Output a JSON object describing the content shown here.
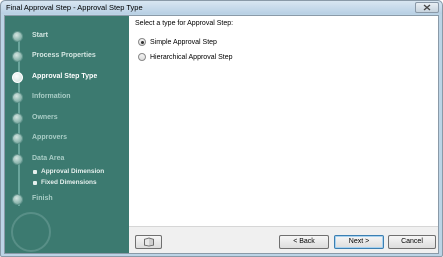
{
  "window": {
    "title": "Final Approval Step - Approval Step Type"
  },
  "sidebar": {
    "steps": [
      {
        "label": "Start",
        "state": "done"
      },
      {
        "label": "Process Properties",
        "state": "done"
      },
      {
        "label": "Approval Step Type",
        "state": "current"
      },
      {
        "label": "Information",
        "state": "pending"
      },
      {
        "label": "Owners",
        "state": "pending"
      },
      {
        "label": "Approvers",
        "state": "pending"
      },
      {
        "label": "Data Area",
        "state": "pending"
      },
      {
        "label": "Finish",
        "state": "pending"
      }
    ],
    "substeps": [
      {
        "label": "Approval Dimension"
      },
      {
        "label": "Fixed Dimensions"
      }
    ]
  },
  "main": {
    "prompt": "Select a type for Approval Step:",
    "options": [
      {
        "label": "Simple Approval Step",
        "checked": true
      },
      {
        "label": "Hierarchical Approval Step",
        "checked": false
      }
    ]
  },
  "footer": {
    "back_label": "< Back",
    "next_label": "Next >",
    "cancel_label": "Cancel",
    "help_icon": "book-icon"
  },
  "colors": {
    "sidebar_bg": "#3c7a70",
    "titlebar": "#c9dcec"
  }
}
